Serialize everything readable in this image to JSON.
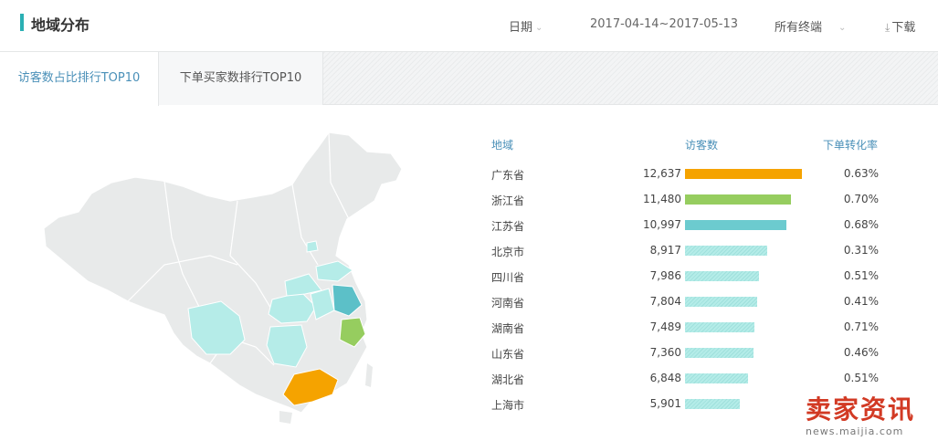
{
  "header": {
    "title": "地域分布",
    "date_label": "日期",
    "date_range": "2017-04-14~2017-05-13",
    "terminal_label": "所有终端",
    "download_label": "下载",
    "accent_color": "#2bb0b4"
  },
  "tabs": [
    {
      "label": "访客数占比排行TOP10",
      "active": true
    },
    {
      "label": "下单买家数排行TOP10",
      "active": false
    }
  ],
  "table": {
    "headers": {
      "region": "地域",
      "visitors": "访客数",
      "conversion": "下单转化率"
    },
    "rows": [
      {
        "region": "广东省",
        "visitors": "12,637",
        "value": 12637,
        "rate": "0.63%",
        "color": "#f5a300"
      },
      {
        "region": "浙江省",
        "visitors": "11,480",
        "value": 11480,
        "rate": "0.70%",
        "color": "#96cd5f"
      },
      {
        "region": "江苏省",
        "visitors": "10,997",
        "value": 10997,
        "rate": "0.68%",
        "color": "#6ccbcf"
      },
      {
        "region": "北京市",
        "visitors": "8,917",
        "value": 8917,
        "rate": "0.31%",
        "color": "light"
      },
      {
        "region": "四川省",
        "visitors": "7,986",
        "value": 7986,
        "rate": "0.51%",
        "color": "light"
      },
      {
        "region": "河南省",
        "visitors": "7,804",
        "value": 7804,
        "rate": "0.41%",
        "color": "light"
      },
      {
        "region": "湖南省",
        "visitors": "7,489",
        "value": 7489,
        "rate": "0.71%",
        "color": "light"
      },
      {
        "region": "山东省",
        "visitors": "7,360",
        "value": 7360,
        "rate": "0.46%",
        "color": "light"
      },
      {
        "region": "湖北省",
        "visitors": "6,848",
        "value": 6848,
        "rate": "0.51%",
        "color": "light"
      },
      {
        "region": "上海市",
        "visitors": "5,901",
        "value": 5901,
        "rate": "",
        "color": "light"
      }
    ]
  },
  "watermark": {
    "big": "卖家资讯",
    "small": "news.maijia.com"
  },
  "icons": {
    "download": "download-icon",
    "chevron": "chevron-down-icon"
  }
}
